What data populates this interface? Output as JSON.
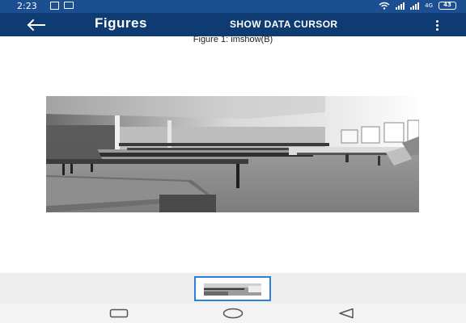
{
  "status_bar": {
    "time": "2:23",
    "network_label": "4G",
    "battery": "43",
    "icons": [
      "message-icon",
      "screen-icon",
      "wifi-icon",
      "signal-icon",
      "battery-icon"
    ]
  },
  "app_bar": {
    "title": "Figures",
    "action_label": "SHOW DATA CURSOR",
    "icons": [
      "back-arrow-icon",
      "overflow-menu-icon"
    ]
  },
  "figure": {
    "title": "Figure 1: imshow(B)",
    "image_description_icon": "grayscale-classroom-image"
  },
  "thumbnails": {
    "selected_index": 0,
    "count": 1
  },
  "navigation": {
    "icons": [
      "recents-icon",
      "home-icon",
      "back-icon"
    ]
  },
  "colors": {
    "status_bar": "#1b4f91",
    "app_bar": "#0d3b72",
    "thumb_border": "#2f7fd6"
  }
}
